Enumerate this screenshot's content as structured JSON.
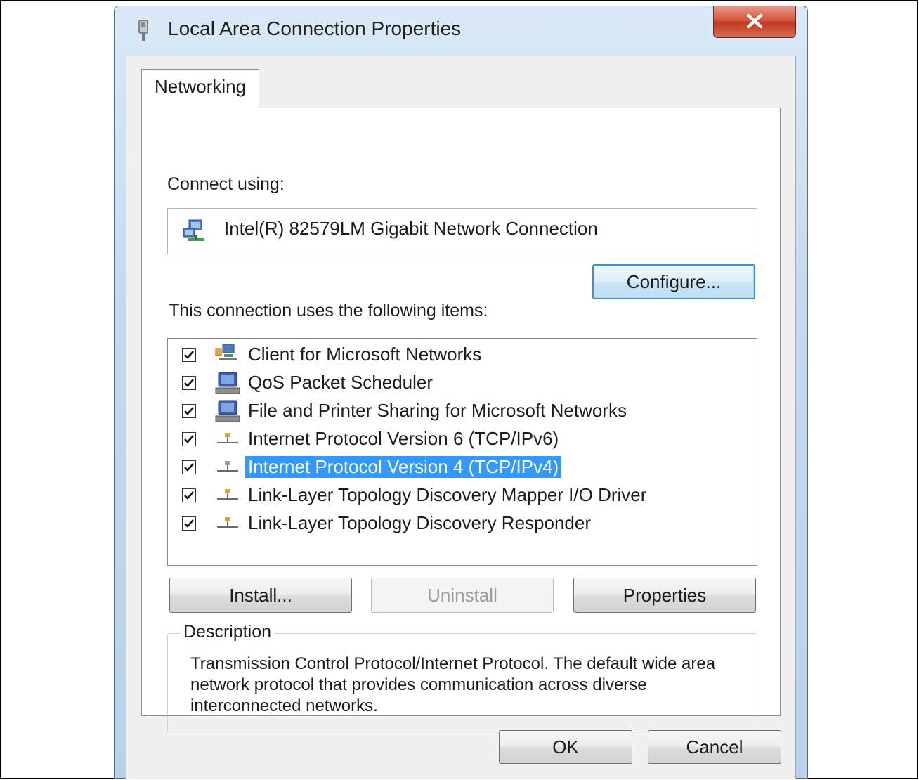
{
  "window": {
    "title": "Local Area Connection Properties"
  },
  "tabs": [
    {
      "label": "Networking",
      "active": true
    }
  ],
  "connect_using": {
    "label": "Connect using:",
    "adapter": "Intel(R) 82579LM Gigabit Network Connection"
  },
  "buttons": {
    "configure": "Configure...",
    "install": "Install...",
    "uninstall": "Uninstall",
    "properties": "Properties",
    "ok": "OK",
    "cancel": "Cancel"
  },
  "items_section": {
    "label": "This connection uses the following items:",
    "items": [
      {
        "label": "Client for Microsoft Networks",
        "checked": true,
        "icon": "network-client-icon",
        "selected": false
      },
      {
        "label": "QoS Packet Scheduler",
        "checked": true,
        "icon": "computer-service-icon",
        "selected": false
      },
      {
        "label": "File and Printer Sharing for Microsoft Networks",
        "checked": true,
        "icon": "computer-service-icon",
        "selected": false
      },
      {
        "label": "Internet Protocol Version 6 (TCP/IPv6)",
        "checked": true,
        "icon": "protocol-icon",
        "selected": false
      },
      {
        "label": "Internet Protocol Version 4 (TCP/IPv4)",
        "checked": true,
        "icon": "protocol-icon",
        "selected": true
      },
      {
        "label": "Link-Layer Topology Discovery Mapper I/O Driver",
        "checked": true,
        "icon": "protocol-icon",
        "selected": false
      },
      {
        "label": "Link-Layer Topology Discovery Responder",
        "checked": true,
        "icon": "protocol-icon",
        "selected": false
      }
    ]
  },
  "description": {
    "legend": "Description",
    "text": "Transmission Control Protocol/Internet Protocol. The default wide area network protocol that provides communication across diverse interconnected networks."
  },
  "colors": {
    "selection": "#3399ff",
    "close_button": "#c9442a",
    "focus_border": "#3c8fd1"
  }
}
